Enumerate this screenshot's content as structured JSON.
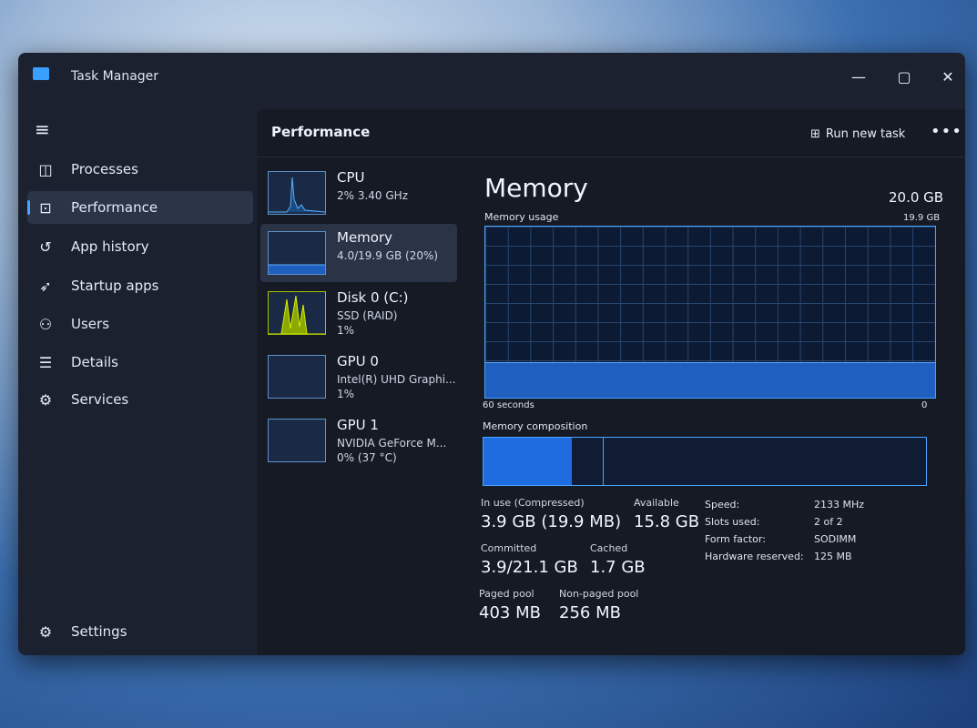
{
  "window": {
    "title": "Task Manager",
    "icons": {
      "app": "task-manager-icon",
      "minimize": "minimize-icon",
      "maximize": "maximize-icon",
      "close": "close-icon"
    }
  },
  "nav": {
    "menu_icon": "hamburger-icon",
    "items": [
      {
        "label": "Processes",
        "icon": "processes-icon",
        "active": false
      },
      {
        "label": "Performance",
        "icon": "performance-icon",
        "active": true
      },
      {
        "label": "App history",
        "icon": "history-icon",
        "active": false
      },
      {
        "label": "Startup apps",
        "icon": "startup-icon",
        "active": false
      },
      {
        "label": "Users",
        "icon": "users-icon",
        "active": false
      },
      {
        "label": "Details",
        "icon": "details-icon",
        "active": false
      },
      {
        "label": "Services",
        "icon": "services-icon",
        "active": false
      }
    ],
    "settings": {
      "label": "Settings",
      "icon": "gear-icon"
    }
  },
  "header": {
    "title": "Performance",
    "run_task": "Run new task",
    "run_task_icon": "run-task-icon",
    "more_icon": "more-icon"
  },
  "devices": [
    {
      "name": "CPU",
      "line1": "2% 3.40 GHz",
      "line2": "",
      "active": false
    },
    {
      "name": "Memory",
      "line1": "4.0/19.9 GB (20%)",
      "line2": "",
      "active": true
    },
    {
      "name": "Disk 0 (C:)",
      "line1": "SSD (RAID)",
      "line2": "1%",
      "active": false
    },
    {
      "name": "GPU 0",
      "line1": "Intel(R) UHD Graphi...",
      "line2": "1%",
      "active": false
    },
    {
      "name": "GPU 1",
      "line1": "NVIDIA GeForce M...",
      "line2": "0% (37 °C)",
      "active": false
    }
  ],
  "memory": {
    "title": "Memory",
    "total": "20.0 GB",
    "usage_label": "Memory usage",
    "usage_max": "19.9 GB",
    "usage_level": 0.2,
    "axis_left": "60 seconds",
    "axis_right": "0",
    "composition_label": "Memory composition",
    "composition": {
      "in_use": 0.2,
      "modified": 0.27
    },
    "stats": {
      "in_use_k": "In use (Compressed)",
      "in_use_v": "3.9 GB (19.9 MB)",
      "available_k": "Available",
      "available_v": "15.8 GB",
      "committed_k": "Committed",
      "committed_v": "3.9/21.1 GB",
      "cached_k": "Cached",
      "cached_v": "1.7 GB",
      "paged_k": "Paged pool",
      "paged_v": "403 MB",
      "nonpaged_k": "Non-paged pool",
      "nonpaged_v": "256 MB"
    },
    "specs": [
      {
        "k": "Speed:",
        "v": "2133 MHz"
      },
      {
        "k": "Slots used:",
        "v": "2 of 2"
      },
      {
        "k": "Form factor:",
        "v": "SODIMM"
      },
      {
        "k": "Hardware reserved:",
        "v": "125 MB"
      }
    ]
  },
  "colors": {
    "accent": "#4aa3ff",
    "disk_graph": "#c8e000",
    "memory_fill": "#1f5fbf"
  }
}
